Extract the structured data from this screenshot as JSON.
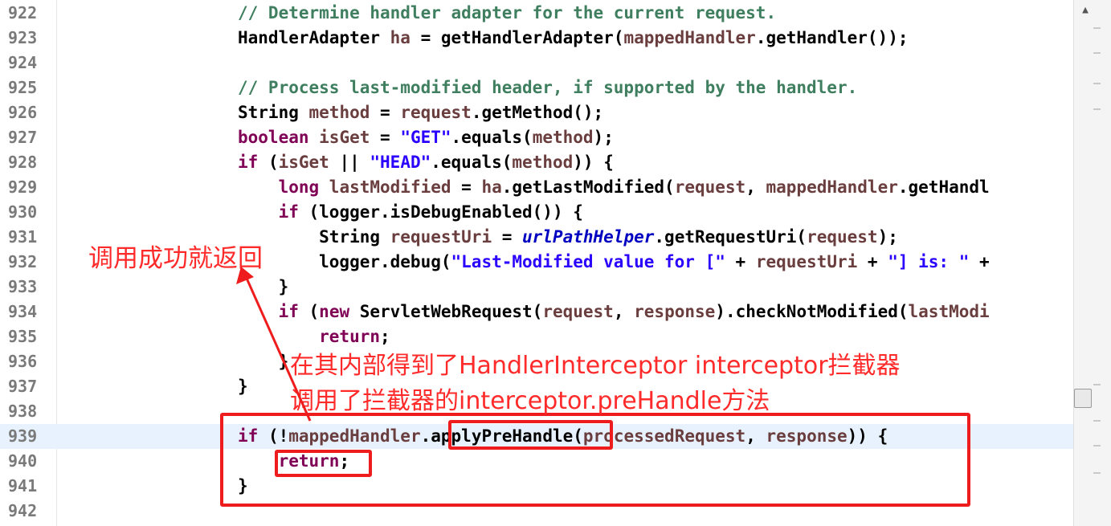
{
  "editor": {
    "lines": [
      {
        "num": "922",
        "tokens": [
          {
            "t": "// Determine handler adapter for the current request.",
            "c": "cmt"
          }
        ]
      },
      {
        "num": "923",
        "tokens": [
          {
            "t": "HandlerAdapter ",
            "c": "pl"
          },
          {
            "t": "ha",
            "c": "var"
          },
          {
            "t": " = getHandlerAdapter(",
            "c": "pl"
          },
          {
            "t": "mappedHandler",
            "c": "var"
          },
          {
            "t": ".getHandler());",
            "c": "pl"
          }
        ]
      },
      {
        "num": "924",
        "tokens": []
      },
      {
        "num": "925",
        "tokens": [
          {
            "t": "// Process last-modified header, if supported by the handler.",
            "c": "cmt"
          }
        ]
      },
      {
        "num": "926",
        "tokens": [
          {
            "t": "String ",
            "c": "pl"
          },
          {
            "t": "method",
            "c": "var"
          },
          {
            "t": " = ",
            "c": "pl"
          },
          {
            "t": "request",
            "c": "var"
          },
          {
            "t": ".getMethod();",
            "c": "pl"
          }
        ]
      },
      {
        "num": "927",
        "tokens": [
          {
            "t": "boolean ",
            "c": "kw"
          },
          {
            "t": "isGet",
            "c": "var"
          },
          {
            "t": " = ",
            "c": "pl"
          },
          {
            "t": "\"GET\"",
            "c": "str"
          },
          {
            "t": ".equals(",
            "c": "pl"
          },
          {
            "t": "method",
            "c": "var"
          },
          {
            "t": ");",
            "c": "pl"
          }
        ]
      },
      {
        "num": "928",
        "tokens": [
          {
            "t": "if ",
            "c": "kw"
          },
          {
            "t": "(",
            "c": "pl"
          },
          {
            "t": "isGet",
            "c": "var"
          },
          {
            "t": " || ",
            "c": "pl"
          },
          {
            "t": "\"HEAD\"",
            "c": "str"
          },
          {
            "t": ".equals(",
            "c": "pl"
          },
          {
            "t": "method",
            "c": "var"
          },
          {
            "t": ")) {",
            "c": "pl"
          }
        ]
      },
      {
        "num": "929",
        "tokens": [
          {
            "t": "    long ",
            "c": "kw"
          },
          {
            "t": "lastModified",
            "c": "var"
          },
          {
            "t": " = ",
            "c": "pl"
          },
          {
            "t": "ha",
            "c": "var"
          },
          {
            "t": ".getLastModified(",
            "c": "pl"
          },
          {
            "t": "request",
            "c": "var"
          },
          {
            "t": ", ",
            "c": "pl"
          },
          {
            "t": "mappedHandler",
            "c": "var"
          },
          {
            "t": ".getHandl",
            "c": "pl"
          }
        ]
      },
      {
        "num": "930",
        "tokens": [
          {
            "t": "    if ",
            "c": "kw"
          },
          {
            "t": "(logger.isDebugEnabled()) {",
            "c": "pl"
          }
        ]
      },
      {
        "num": "931",
        "tokens": [
          {
            "t": "        String ",
            "c": "pl"
          },
          {
            "t": "requestUri",
            "c": "var"
          },
          {
            "t": " = ",
            "c": "pl"
          },
          {
            "t": "urlPathHelper",
            "c": "stat"
          },
          {
            "t": ".getRequestUri(",
            "c": "pl"
          },
          {
            "t": "request",
            "c": "var"
          },
          {
            "t": ");",
            "c": "pl"
          }
        ]
      },
      {
        "num": "932",
        "tokens": [
          {
            "t": "        logger.debug(",
            "c": "pl"
          },
          {
            "t": "\"Last-Modified value for [\"",
            "c": "str"
          },
          {
            "t": " + ",
            "c": "pl"
          },
          {
            "t": "requestUri",
            "c": "var"
          },
          {
            "t": " + ",
            "c": "pl"
          },
          {
            "t": "\"] is: \"",
            "c": "str"
          },
          {
            "t": " +",
            "c": "pl"
          }
        ]
      },
      {
        "num": "933",
        "tokens": [
          {
            "t": "    }",
            "c": "pl"
          }
        ]
      },
      {
        "num": "934",
        "tokens": [
          {
            "t": "    if ",
            "c": "kw"
          },
          {
            "t": "(",
            "c": "pl"
          },
          {
            "t": "new ",
            "c": "kw"
          },
          {
            "t": "ServletWebRequest(",
            "c": "pl"
          },
          {
            "t": "request",
            "c": "var"
          },
          {
            "t": ", ",
            "c": "pl"
          },
          {
            "t": "response",
            "c": "var"
          },
          {
            "t": ").checkNotModified(",
            "c": "pl"
          },
          {
            "t": "lastModi",
            "c": "var"
          }
        ]
      },
      {
        "num": "935",
        "tokens": [
          {
            "t": "        return",
            "c": "kw"
          },
          {
            "t": ";",
            "c": "pl"
          }
        ]
      },
      {
        "num": "936",
        "tokens": [
          {
            "t": "    }",
            "c": "pl"
          }
        ]
      },
      {
        "num": "937",
        "tokens": [
          {
            "t": "}",
            "c": "pl"
          }
        ]
      },
      {
        "num": "938",
        "tokens": []
      },
      {
        "num": "939",
        "current": true,
        "tokens": [
          {
            "t": "if ",
            "c": "kw"
          },
          {
            "t": "(!",
            "c": "pl"
          },
          {
            "t": "mappedHandler",
            "c": "var"
          },
          {
            "t": ".applyPreHandle(",
            "c": "pl"
          },
          {
            "t": "processedRequest",
            "c": "var"
          },
          {
            "t": ", ",
            "c": "pl"
          },
          {
            "t": "response",
            "c": "var"
          },
          {
            "t": ")) {",
            "c": "pl"
          }
        ]
      },
      {
        "num": "940",
        "tokens": [
          {
            "t": "    return",
            "c": "kw"
          },
          {
            "t": ";",
            "c": "pl"
          }
        ]
      },
      {
        "num": "941",
        "tokens": [
          {
            "t": "}",
            "c": "pl"
          }
        ]
      },
      {
        "num": "942",
        "tokens": []
      }
    ]
  },
  "annotations": {
    "return_note": "调用成功就返回",
    "inner_note": "在其内部得到了HandlerInterceptor interceptor拦截器",
    "prehandle_note": "调用了拦截器的interceptor.preHandle方法"
  },
  "colors": {
    "annotation": "#ff2a2a",
    "keyword": "#7f0055",
    "comment": "#3f7f5f",
    "string": "#2a00ff",
    "variable": "#6a3e3e",
    "static_field": "#0000c0",
    "current_line": "#e8f2fe"
  },
  "scrollbar": {
    "up_icon": "chevron-up-icon"
  }
}
